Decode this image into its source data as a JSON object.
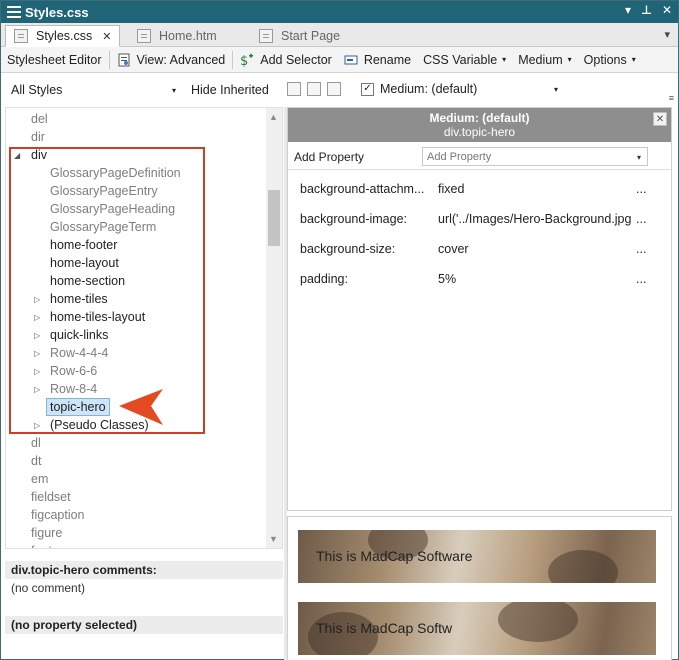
{
  "window": {
    "title": "Styles.css"
  },
  "tabs": [
    {
      "label": "Styles.css",
      "active": true
    },
    {
      "label": "Home.htm",
      "active": false
    },
    {
      "label": "Start Page",
      "active": false
    }
  ],
  "toolbar": {
    "editor": "Stylesheet Editor",
    "view": "View: Advanced",
    "add_selector": "Add Selector",
    "rename": "Rename",
    "css_variable": "CSS Variable",
    "medium": "Medium",
    "options": "Options"
  },
  "filter": {
    "all_styles": "All Styles",
    "hide_inherited": "Hide Inherited",
    "medium_label": "Medium: (default)",
    "medium_checked": true
  },
  "tree": {
    "items": [
      {
        "label": "del"
      },
      {
        "label": "dir"
      },
      {
        "label": "div"
      },
      {
        "label": "GlossaryPageDefinition"
      },
      {
        "label": "GlossaryPageEntry"
      },
      {
        "label": "GlossaryPageHeading"
      },
      {
        "label": "GlossaryPageTerm"
      },
      {
        "label": "home-footer"
      },
      {
        "label": "home-layout"
      },
      {
        "label": "home-section"
      },
      {
        "label": "home-tiles"
      },
      {
        "label": "home-tiles-layout"
      },
      {
        "label": "quick-links"
      },
      {
        "label": "Row-4-4-4"
      },
      {
        "label": "Row-6-6"
      },
      {
        "label": "Row-8-4"
      },
      {
        "label": "topic-hero"
      },
      {
        "label": "(Pseudo Classes)"
      },
      {
        "label": "dl"
      },
      {
        "label": "dt"
      },
      {
        "label": "em"
      },
      {
        "label": "fieldset"
      },
      {
        "label": "figcaption"
      },
      {
        "label": "figure"
      },
      {
        "label": "footer"
      }
    ],
    "selected": "topic-hero"
  },
  "comments": {
    "title": "div.topic-hero comments:",
    "body": "(no comment)",
    "property_status": "(no property selected)"
  },
  "properties": {
    "medium": "Medium: (default)",
    "selector": "div.topic-hero",
    "add_property_label": "Add Property",
    "add_property_placeholder": "Add Property",
    "rows": [
      {
        "name": "background-attachm...",
        "value": "fixed",
        "more": "..."
      },
      {
        "name": "background-image:",
        "value": "url('../Images/Hero-Background.jpg",
        "more": "..."
      },
      {
        "name": "background-size:",
        "value": "cover",
        "more": "..."
      },
      {
        "name": "padding:",
        "value": "5%",
        "more": "..."
      }
    ]
  },
  "preview": {
    "heroes": [
      {
        "text": "This is MadCap Software"
      },
      {
        "text": "This is MadCap Softw"
      }
    ]
  },
  "colors": {
    "titlebar": "#1f6577",
    "highlight": "#cc3f24",
    "arrow": "#e34a22",
    "selection": "#cde6f7"
  }
}
